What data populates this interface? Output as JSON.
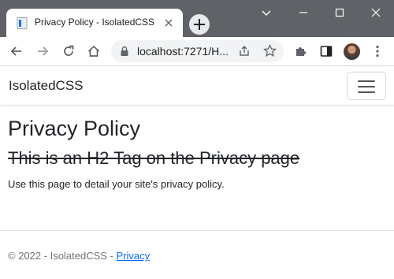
{
  "browser": {
    "tab_title": "Privacy Policy - IsolatedCSS",
    "url": "localhost:7271/H...",
    "colors": {
      "titlebar": "#5f6368",
      "omnibox": "#f1f3f4"
    }
  },
  "icons": {
    "favicon": "document-icon",
    "tab_close": "close-icon",
    "new_tab": "plus-icon",
    "chevron": "chevron-down-icon",
    "minimize": "minimize-icon",
    "maximize": "maximize-icon",
    "close_window": "close-icon",
    "back": "back-arrow-icon",
    "forward": "forward-arrow-icon",
    "reload": "reload-icon",
    "home": "home-icon",
    "lock": "lock-icon",
    "share": "share-icon",
    "bookmark": "star-icon",
    "extensions": "puzzle-icon",
    "side_panel": "side-panel-icon",
    "profile": "avatar",
    "menu": "kebab-menu-icon",
    "navbar_toggler": "hamburger-icon"
  },
  "page": {
    "brand": "IsolatedCSS",
    "heading": "Privacy Policy",
    "subheading": "This is an H2 Tag on the Privacy page",
    "paragraph": "Use this page to detail your site's privacy policy.",
    "footer": {
      "copyright": "© 2022 - IsolatedCSS - ",
      "privacy_link": "Privacy"
    },
    "colors": {
      "text": "#212529",
      "link": "#0d6efd",
      "muted": "#6c757d"
    }
  }
}
